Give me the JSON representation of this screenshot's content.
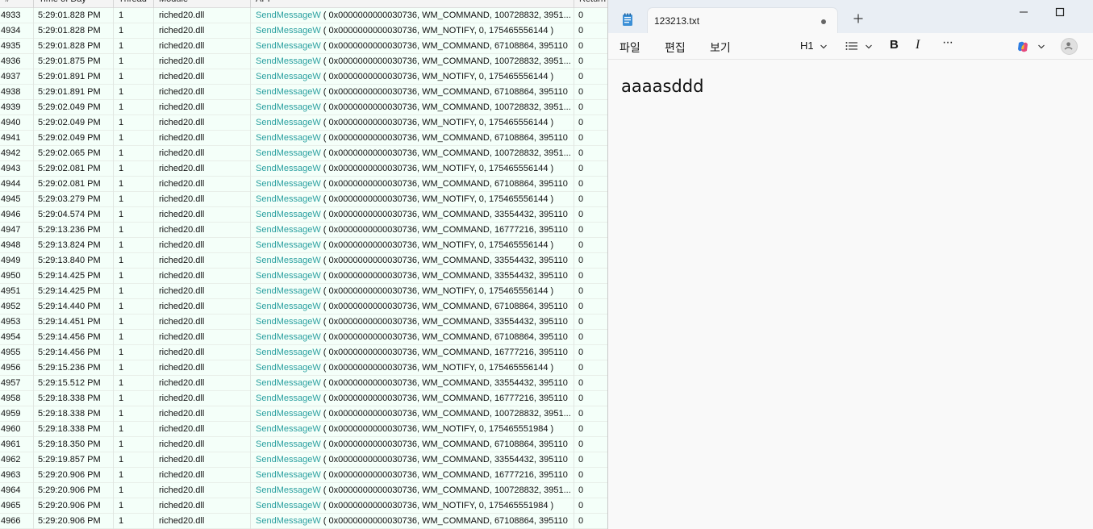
{
  "log": {
    "headers": {
      "num": "#",
      "time": "Time of Day",
      "thread": "Thread",
      "module": "Module",
      "api": "API",
      "ret": "Return"
    },
    "rows": [
      {
        "num": "4933",
        "time": "5:29:01.828 PM",
        "thread": "1",
        "module": "riched20.dll",
        "api": "SendMessageW",
        "args": "( 0x0000000000030736, WM_COMMAND, 100728832, 3951...",
        "ret": "0"
      },
      {
        "num": "4934",
        "time": "5:29:01.828 PM",
        "thread": "1",
        "module": "riched20.dll",
        "api": "SendMessageW",
        "args": "( 0x0000000000030736, WM_NOTIFY, 0, 175465556144 )",
        "ret": "0"
      },
      {
        "num": "4935",
        "time": "5:29:01.828 PM",
        "thread": "1",
        "module": "riched20.dll",
        "api": "SendMessageW",
        "args": "( 0x0000000000030736, WM_COMMAND, 67108864, 395110",
        "ret": "0"
      },
      {
        "num": "4936",
        "time": "5:29:01.875 PM",
        "thread": "1",
        "module": "riched20.dll",
        "api": "SendMessageW",
        "args": "( 0x0000000000030736, WM_COMMAND, 100728832, 3951...",
        "ret": "0"
      },
      {
        "num": "4937",
        "time": "5:29:01.891 PM",
        "thread": "1",
        "module": "riched20.dll",
        "api": "SendMessageW",
        "args": "( 0x0000000000030736, WM_NOTIFY, 0, 175465556144 )",
        "ret": "0"
      },
      {
        "num": "4938",
        "time": "5:29:01.891 PM",
        "thread": "1",
        "module": "riched20.dll",
        "api": "SendMessageW",
        "args": "( 0x0000000000030736, WM_COMMAND, 67108864, 395110",
        "ret": "0"
      },
      {
        "num": "4939",
        "time": "5:29:02.049 PM",
        "thread": "1",
        "module": "riched20.dll",
        "api": "SendMessageW",
        "args": "( 0x0000000000030736, WM_COMMAND, 100728832, 3951...",
        "ret": "0"
      },
      {
        "num": "4940",
        "time": "5:29:02.049 PM",
        "thread": "1",
        "module": "riched20.dll",
        "api": "SendMessageW",
        "args": "( 0x0000000000030736, WM_NOTIFY, 0, 175465556144 )",
        "ret": "0"
      },
      {
        "num": "4941",
        "time": "5:29:02.049 PM",
        "thread": "1",
        "module": "riched20.dll",
        "api": "SendMessageW",
        "args": "( 0x0000000000030736, WM_COMMAND, 67108864, 395110",
        "ret": "0"
      },
      {
        "num": "4942",
        "time": "5:29:02.065 PM",
        "thread": "1",
        "module": "riched20.dll",
        "api": "SendMessageW",
        "args": "( 0x0000000000030736, WM_COMMAND, 100728832, 3951...",
        "ret": "0"
      },
      {
        "num": "4943",
        "time": "5:29:02.081 PM",
        "thread": "1",
        "module": "riched20.dll",
        "api": "SendMessageW",
        "args": "( 0x0000000000030736, WM_NOTIFY, 0, 175465556144 )",
        "ret": "0"
      },
      {
        "num": "4944",
        "time": "5:29:02.081 PM",
        "thread": "1",
        "module": "riched20.dll",
        "api": "SendMessageW",
        "args": "( 0x0000000000030736, WM_COMMAND, 67108864, 395110",
        "ret": "0"
      },
      {
        "num": "4945",
        "time": "5:29:03.279 PM",
        "thread": "1",
        "module": "riched20.dll",
        "api": "SendMessageW",
        "args": "( 0x0000000000030736, WM_NOTIFY, 0, 175465556144 )",
        "ret": "0"
      },
      {
        "num": "4946",
        "time": "5:29:04.574 PM",
        "thread": "1",
        "module": "riched20.dll",
        "api": "SendMessageW",
        "args": "( 0x0000000000030736, WM_COMMAND, 33554432, 395110",
        "ret": "0"
      },
      {
        "num": "4947",
        "time": "5:29:13.236 PM",
        "thread": "1",
        "module": "riched20.dll",
        "api": "SendMessageW",
        "args": "( 0x0000000000030736, WM_COMMAND, 16777216, 395110",
        "ret": "0"
      },
      {
        "num": "4948",
        "time": "5:29:13.824 PM",
        "thread": "1",
        "module": "riched20.dll",
        "api": "SendMessageW",
        "args": "( 0x0000000000030736, WM_NOTIFY, 0, 175465556144 )",
        "ret": "0"
      },
      {
        "num": "4949",
        "time": "5:29:13.840 PM",
        "thread": "1",
        "module": "riched20.dll",
        "api": "SendMessageW",
        "args": "( 0x0000000000030736, WM_COMMAND, 33554432, 395110",
        "ret": "0"
      },
      {
        "num": "4950",
        "time": "5:29:14.425 PM",
        "thread": "1",
        "module": "riched20.dll",
        "api": "SendMessageW",
        "args": "( 0x0000000000030736, WM_COMMAND, 33554432, 395110",
        "ret": "0"
      },
      {
        "num": "4951",
        "time": "5:29:14.425 PM",
        "thread": "1",
        "module": "riched20.dll",
        "api": "SendMessageW",
        "args": "( 0x0000000000030736, WM_NOTIFY, 0, 175465556144 )",
        "ret": "0"
      },
      {
        "num": "4952",
        "time": "5:29:14.440 PM",
        "thread": "1",
        "module": "riched20.dll",
        "api": "SendMessageW",
        "args": "( 0x0000000000030736, WM_COMMAND, 67108864, 395110",
        "ret": "0"
      },
      {
        "num": "4953",
        "time": "5:29:14.451 PM",
        "thread": "1",
        "module": "riched20.dll",
        "api": "SendMessageW",
        "args": "( 0x0000000000030736, WM_COMMAND, 33554432, 395110",
        "ret": "0"
      },
      {
        "num": "4954",
        "time": "5:29:14.456 PM",
        "thread": "1",
        "module": "riched20.dll",
        "api": "SendMessageW",
        "args": "( 0x0000000000030736, WM_COMMAND, 67108864, 395110",
        "ret": "0"
      },
      {
        "num": "4955",
        "time": "5:29:14.456 PM",
        "thread": "1",
        "module": "riched20.dll",
        "api": "SendMessageW",
        "args": "( 0x0000000000030736, WM_COMMAND, 16777216, 395110",
        "ret": "0"
      },
      {
        "num": "4956",
        "time": "5:29:15.236 PM",
        "thread": "1",
        "module": "riched20.dll",
        "api": "SendMessageW",
        "args": "( 0x0000000000030736, WM_NOTIFY, 0, 175465556144 )",
        "ret": "0"
      },
      {
        "num": "4957",
        "time": "5:29:15.512 PM",
        "thread": "1",
        "module": "riched20.dll",
        "api": "SendMessageW",
        "args": "( 0x0000000000030736, WM_COMMAND, 33554432, 395110",
        "ret": "0"
      },
      {
        "num": "4958",
        "time": "5:29:18.338 PM",
        "thread": "1",
        "module": "riched20.dll",
        "api": "SendMessageW",
        "args": "( 0x0000000000030736, WM_COMMAND, 16777216, 395110",
        "ret": "0"
      },
      {
        "num": "4959",
        "time": "5:29:18.338 PM",
        "thread": "1",
        "module": "riched20.dll",
        "api": "SendMessageW",
        "args": "( 0x0000000000030736, WM_COMMAND, 100728832, 3951...",
        "ret": "0"
      },
      {
        "num": "4960",
        "time": "5:29:18.338 PM",
        "thread": "1",
        "module": "riched20.dll",
        "api": "SendMessageW",
        "args": "( 0x0000000000030736, WM_NOTIFY, 0, 175465551984 )",
        "ret": "0"
      },
      {
        "num": "4961",
        "time": "5:29:18.350 PM",
        "thread": "1",
        "module": "riched20.dll",
        "api": "SendMessageW",
        "args": "( 0x0000000000030736, WM_COMMAND, 67108864, 395110",
        "ret": "0"
      },
      {
        "num": "4962",
        "time": "5:29:19.857 PM",
        "thread": "1",
        "module": "riched20.dll",
        "api": "SendMessageW",
        "args": "( 0x0000000000030736, WM_COMMAND, 33554432, 395110",
        "ret": "0"
      },
      {
        "num": "4963",
        "time": "5:29:20.906 PM",
        "thread": "1",
        "module": "riched20.dll",
        "api": "SendMessageW",
        "args": "( 0x0000000000030736, WM_COMMAND, 16777216, 395110",
        "ret": "0"
      },
      {
        "num": "4964",
        "time": "5:29:20.906 PM",
        "thread": "1",
        "module": "riched20.dll",
        "api": "SendMessageW",
        "args": "( 0x0000000000030736, WM_COMMAND, 100728832, 3951...",
        "ret": "0"
      },
      {
        "num": "4965",
        "time": "5:29:20.906 PM",
        "thread": "1",
        "module": "riched20.dll",
        "api": "SendMessageW",
        "args": "( 0x0000000000030736, WM_NOTIFY, 0, 175465551984 )",
        "ret": "0"
      },
      {
        "num": "4966",
        "time": "5:29:20.906 PM",
        "thread": "1",
        "module": "riched20.dll",
        "api": "SendMessageW",
        "args": "( 0x0000000000030736, WM_COMMAND, 67108864, 395110",
        "ret": "0"
      }
    ],
    "colors": {
      "api_name": "#2aa0a0",
      "row_bg": "#f4fff9"
    }
  },
  "notepad": {
    "tab_title": "123213.txt",
    "menu": {
      "file": "파일",
      "edit": "편집",
      "view": "보기"
    },
    "toolbar": {
      "heading": "H1",
      "bold": "B",
      "italic": "I",
      "more": "···"
    },
    "content": "aaaasddd",
    "icons": [
      "notepad-icon",
      "unsaved-dot-icon",
      "new-tab-icon",
      "minimize-icon",
      "maximize-icon",
      "chevron-down-icon",
      "list-icon",
      "copilot-icon",
      "account-icon",
      "settings-icon"
    ]
  }
}
